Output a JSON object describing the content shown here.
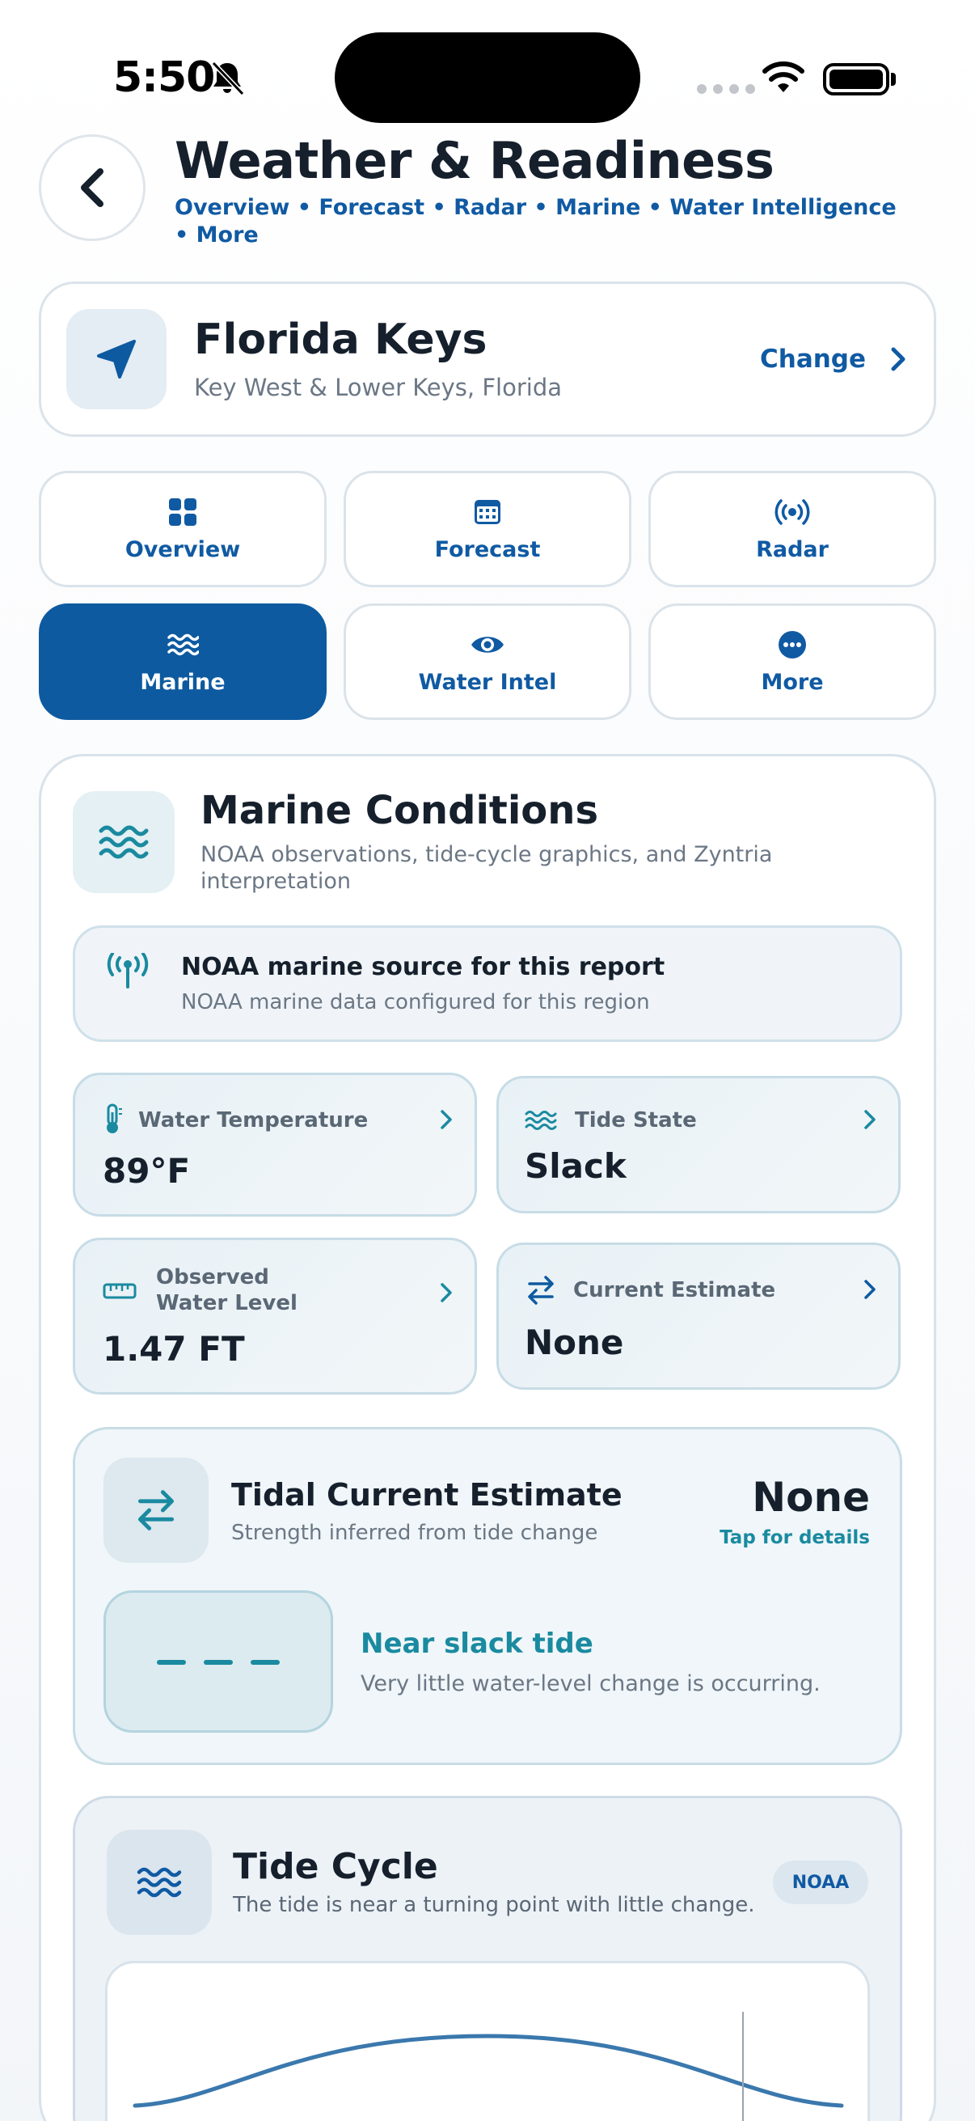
{
  "status_bar": {
    "time": "5:50"
  },
  "header": {
    "title": "Weather & Readiness",
    "breadcrumb": "Overview • Forecast • Radar • Marine • Water Intelligence • More"
  },
  "location": {
    "name": "Florida Keys",
    "subtitle": "Key West & Lower Keys, Florida",
    "change_label": "Change"
  },
  "tabs": [
    {
      "label": "Overview",
      "icon": "grid-icon",
      "active": false
    },
    {
      "label": "Forecast",
      "icon": "calendar-icon",
      "active": false
    },
    {
      "label": "Radar",
      "icon": "broadcast-icon",
      "active": false
    },
    {
      "label": "Marine",
      "icon": "waves-icon",
      "active": true
    },
    {
      "label": "Water Intel",
      "icon": "eye-icon",
      "active": false
    },
    {
      "label": "More",
      "icon": "more-icon",
      "active": false
    }
  ],
  "marine": {
    "title": "Marine Conditions",
    "subtitle": "NOAA observations, tide-cycle graphics, and Zyntria interpretation",
    "source": {
      "title": "NOAA marine source for this report",
      "subtitle": "NOAA marine data configured for this region"
    },
    "metrics": [
      {
        "label": "Water Temperature",
        "value": "89°F",
        "icon": "thermometer-icon"
      },
      {
        "label": "Tide State",
        "value": "Slack",
        "icon": "waves-icon"
      },
      {
        "label": "Observed\nWater Level",
        "value": "1.47 FT",
        "icon": "ruler-icon"
      },
      {
        "label": "Current Estimate",
        "value": "None",
        "icon": "arrows-icon"
      }
    ],
    "tidal_current": {
      "title": "Tidal Current Estimate",
      "subtitle": "Strength inferred from tide change",
      "value": "None",
      "tap_label": "Tap for details",
      "state": "Near slack tide",
      "description": "Very little water-level change is occurring."
    },
    "tide_cycle": {
      "title": "Tide Cycle",
      "subtitle": "The tide is near a turning point with little change.",
      "badge": "NOAA"
    }
  },
  "colors": {
    "accent": "#0D5AA0",
    "teal": "#1A8AA0",
    "text": "#16202C"
  }
}
